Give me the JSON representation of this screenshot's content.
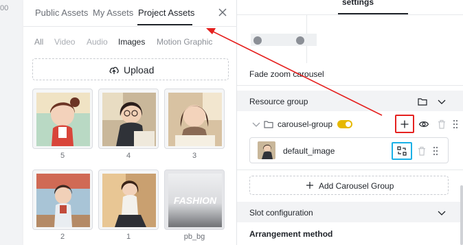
{
  "ruler": {
    "text": "00"
  },
  "asset_panel": {
    "tabs": [
      {
        "label": "Public Assets",
        "active": false
      },
      {
        "label": "My Assets",
        "active": false
      },
      {
        "label": "Project Assets",
        "active": true
      }
    ],
    "close_icon": "close-icon",
    "filters": [
      {
        "label": "All",
        "state": "mid"
      },
      {
        "label": "Video",
        "state": "disabled"
      },
      {
        "label": "Audio",
        "state": "disabled"
      },
      {
        "label": "Images",
        "state": "selected"
      },
      {
        "label": "Motion Graphic",
        "state": "mid"
      }
    ],
    "upload": {
      "label": "Upload",
      "icon": "cloud-upload-icon"
    },
    "assets": [
      {
        "label": "5"
      },
      {
        "label": "4"
      },
      {
        "label": "3"
      },
      {
        "label": "2"
      },
      {
        "label": "1"
      },
      {
        "label": "pb_bg",
        "watermark": "FASHION"
      }
    ]
  },
  "settings_panel": {
    "tab_label": "settings",
    "preview_caption": "Fade zoom carousel",
    "resource_group": {
      "title": "Resource group",
      "carousel_group": {
        "name": "carousel-group",
        "toggle_on": true
      },
      "image_item": {
        "name": "default_image"
      },
      "add_button_label": "Add Carousel Group"
    },
    "slot_configuration": {
      "title": "Slot configuration"
    },
    "arrangement": {
      "title": "Arrangement method"
    }
  },
  "colors": {
    "highlight_red": "#e5211f",
    "highlight_blue": "#1ab0e6",
    "toggle_yellow": "#e6b800"
  }
}
